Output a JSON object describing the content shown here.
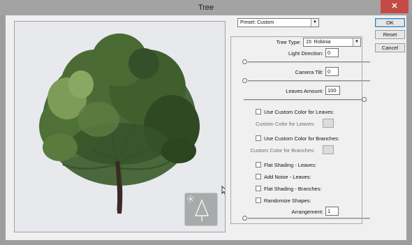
{
  "window": {
    "title": "Tree",
    "close_glyph": "✕"
  },
  "preset": {
    "label": "Preset: Custom"
  },
  "tree_type": {
    "label": "Tree Type:",
    "value": "15: Robinia"
  },
  "light_direction": {
    "label": "Light Direction:",
    "value": "0",
    "slider_fraction": 0.0
  },
  "camera_tilt": {
    "label": "Camera Tilt:",
    "value": "0",
    "slider_fraction": 0.0
  },
  "leaves_amount": {
    "label": "Leaves Amount:",
    "value": "100",
    "slider_fraction": 1.0
  },
  "custom_leaves": {
    "checkbox_label": "Use Custom Color for Leaves:",
    "checked": false,
    "color_label": "Custom Color for Leaves:",
    "color": "#dcdcdc"
  },
  "custom_branches": {
    "checkbox_label": "Use Custom Color for Branches:",
    "checked": false,
    "color_label": "Custom Color for Branches:",
    "color": "#dcdcdc"
  },
  "options": [
    {
      "label": "Flat Shading - Leaves:",
      "checked": false
    },
    {
      "label": "Add Noise - Leaves:",
      "checked": false
    },
    {
      "label": "Flat Shading - Branches:",
      "checked": false
    },
    {
      "label": "Randomize Shapes:",
      "checked": false
    }
  ],
  "arrangement": {
    "label": "Arrangement:",
    "value": "1",
    "slider_fraction": 0.0
  },
  "buttons": {
    "ok": "OK",
    "reset": "Reset",
    "cancel": "Cancel"
  },
  "icons": {
    "close": "close-icon",
    "dropdown": "chevron-down-icon",
    "light": "light-source-icon",
    "tree_thumb": "tree-icon",
    "cursor": "mouse-pointer-icon"
  },
  "colors": {
    "titlebar": "#a3a3a3",
    "close_button": "#c44b45",
    "dialog_bg": "#f0f0f0",
    "preview_bg": "#e7e9ec",
    "foliage_dark": "#2f4a22",
    "foliage_mid": "#4c6b34",
    "foliage_light": "#7f9b58",
    "trunk": "#3a2a22"
  }
}
